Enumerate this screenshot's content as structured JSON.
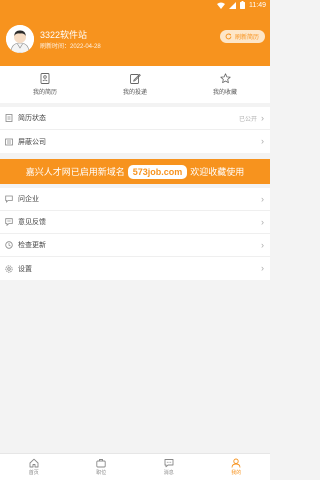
{
  "status": {
    "time": "11:49"
  },
  "profile": {
    "name": "3322软件站",
    "refresh_time": "刷新时间：2022-04-28",
    "refresh_button": "刷新简历"
  },
  "quick_links": [
    {
      "label": "我的简历",
      "icon": "resume-icon"
    },
    {
      "label": "我的投递",
      "icon": "edit-icon"
    },
    {
      "label": "我的收藏",
      "icon": "star-icon"
    }
  ],
  "list_top": [
    {
      "label": "简历状态",
      "right": "已公开",
      "icon": "doc-icon"
    },
    {
      "label": "屏蔽公司",
      "right": "",
      "icon": "block-icon"
    }
  ],
  "banner": {
    "prefix": "嘉兴人才网已启用新域名",
    "domain": "573job.com",
    "suffix": "欢迎收藏使用"
  },
  "list_bottom": [
    {
      "label": "问企业",
      "icon": "chat-icon"
    },
    {
      "label": "意见反馈",
      "icon": "feedback-icon"
    },
    {
      "label": "检查更新",
      "icon": "update-icon"
    },
    {
      "label": "设置",
      "icon": "settings-icon"
    }
  ],
  "tabs": [
    {
      "label": "首页",
      "icon": "home-icon",
      "active": false
    },
    {
      "label": "职位",
      "icon": "briefcase-icon",
      "active": false
    },
    {
      "label": "消息",
      "icon": "message-icon",
      "active": false
    },
    {
      "label": "我的",
      "icon": "user-icon",
      "active": true
    }
  ],
  "colors": {
    "accent": "#f7931e",
    "background": "#f3f3f3"
  }
}
